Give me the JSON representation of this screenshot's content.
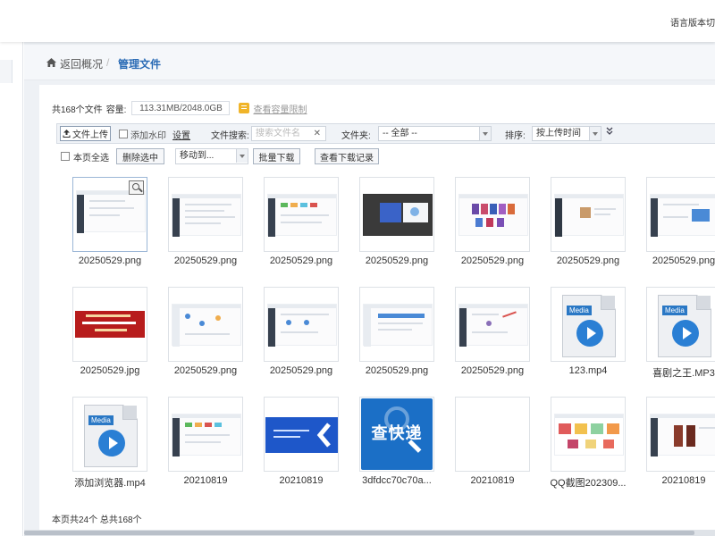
{
  "topbar": {
    "language_label": "语言版本切"
  },
  "breadcrumb": {
    "back_label": "返回概况",
    "separator": "/",
    "current_label": "管理文件"
  },
  "storage": {
    "summary_prefix": "共168个文件",
    "capacity_label": "容量:",
    "capacity_value": "113.31MB/2048.0GB",
    "view_limit_label": "查看容量限制"
  },
  "toolbar": {
    "upload_label": "文件上传",
    "watermark_label": "添加水印",
    "watermark_settings_label": "设置",
    "file_search_label": "文件搜索:",
    "file_search_placeholder": "搜索文件名",
    "clear_glyph": "✕",
    "folder_label": "文件夹:",
    "folder_selected": "-- 全部 --",
    "sort_label": "排序:",
    "sort_selected": "按上传时间",
    "expand_glyph": "¥"
  },
  "actions": {
    "select_page_label": "本页全选",
    "delete_selected_label": "删除选中",
    "move_to_selected": "移动到...",
    "batch_download_label": "批量下载",
    "download_log_label": "查看下载记录"
  },
  "files": [
    {
      "name": "20250529.png"
    },
    {
      "name": "20250529.png"
    },
    {
      "name": "20250529.png"
    },
    {
      "name": "20250529.png"
    },
    {
      "name": "20250529.png"
    },
    {
      "name": "20250529.png"
    },
    {
      "name": "20250529.png"
    },
    {
      "name": "20250529.jpg"
    },
    {
      "name": "20250529.png"
    },
    {
      "name": "20250529.png"
    },
    {
      "name": "20250529.png"
    },
    {
      "name": "20250529.png"
    },
    {
      "name": "123.mp4",
      "media_tag": "Media"
    },
    {
      "name": "喜剧之王.MP3",
      "media_tag": "Media"
    },
    {
      "name": "添加浏览器.mp4",
      "media_tag": "Media"
    },
    {
      "name": "20210819"
    },
    {
      "name": "20210819"
    },
    {
      "name": "3dfdcc70c70a...",
      "logo_text": "查快递"
    },
    {
      "name": "20210819"
    },
    {
      "name": "QQ截图202309..."
    },
    {
      "name": "20210819"
    }
  ],
  "footer": {
    "page_summary": "本页共24个 总共168个"
  },
  "colors": {
    "accent_blue": "#2a6bb5",
    "media_blue": "#2a7fd4",
    "limit_yellow": "#f0b429"
  }
}
